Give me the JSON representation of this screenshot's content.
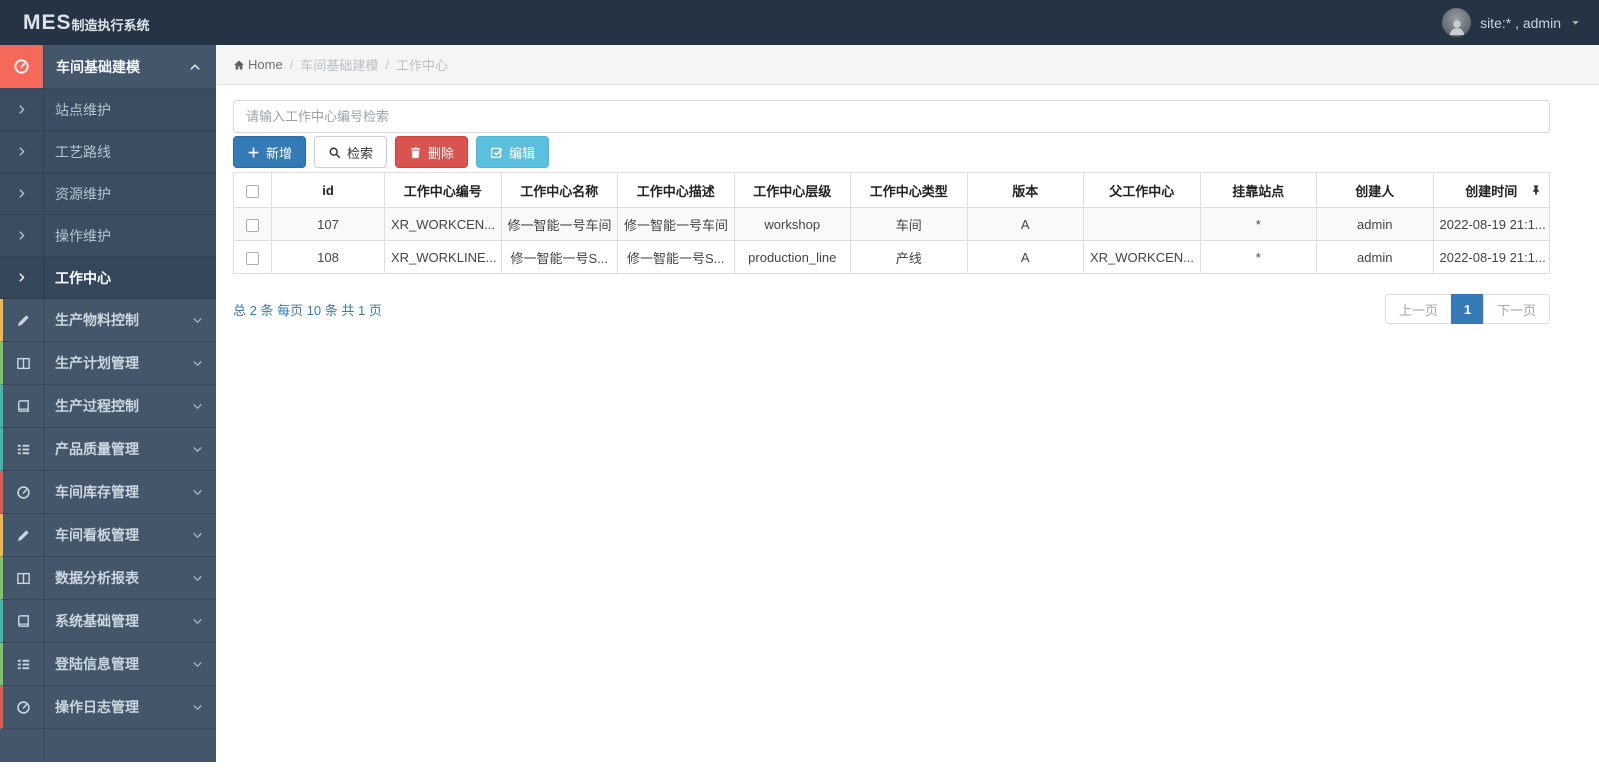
{
  "header": {
    "logo_mes": "MES",
    "logo_suffix": "制造执行系统",
    "user_label": "site:* , admin"
  },
  "sidebar": {
    "parent": {
      "label": "车间基础建模",
      "icon": "gauge-icon"
    },
    "submenu": [
      {
        "label": "站点维护",
        "icon": "chevron-right-icon",
        "active": false
      },
      {
        "label": "工艺路线",
        "icon": "chevron-right-icon",
        "active": false
      },
      {
        "label": "资源维护",
        "icon": "chevron-right-icon",
        "active": false
      },
      {
        "label": "操作维护",
        "icon": "chevron-right-icon",
        "active": false
      },
      {
        "label": "工作中心",
        "icon": "chevron-right-icon",
        "active": true
      }
    ],
    "items": [
      {
        "label": "生产物料控制",
        "icon": "pencil-icon",
        "accent": "#efb74d"
      },
      {
        "label": "生产计划管理",
        "icon": "columns-icon",
        "accent": "#7cc36a"
      },
      {
        "label": "生产过程控制",
        "icon": "book-icon",
        "accent": "#45b6aa"
      },
      {
        "label": "产品质量管理",
        "icon": "list-icon",
        "accent": "#45b6aa"
      },
      {
        "label": "车间库存管理",
        "icon": "gauge-icon",
        "accent": "#e25b52"
      },
      {
        "label": "车间看板管理",
        "icon": "pencil-icon",
        "accent": "#efb74d"
      },
      {
        "label": "数据分析报表",
        "icon": "columns-icon",
        "accent": "#7cc36a"
      },
      {
        "label": "系统基础管理",
        "icon": "book-icon",
        "accent": "#45b6aa"
      },
      {
        "label": "登陆信息管理",
        "icon": "list-icon",
        "accent": "#7cc36a"
      },
      {
        "label": "操作日志管理",
        "icon": "gauge-icon",
        "accent": "#e25b52"
      }
    ]
  },
  "breadcrumb": {
    "home": "Home",
    "sep": "/",
    "section": "车间基础建模",
    "page": "工作中心"
  },
  "toolbar": {
    "search_placeholder": "请输入工作中心编号检索",
    "add_label": "新增",
    "search_label": "检索",
    "delete_label": "删除",
    "edit_label": "编辑"
  },
  "table": {
    "columns": [
      "id",
      "工作中心编号",
      "工作中心名称",
      "工作中心描述",
      "工作中心层级",
      "工作中心类型",
      "版本",
      "父工作中心",
      "挂靠站点",
      "创建人",
      "创建时间"
    ],
    "rows": [
      {
        "id": "107",
        "code": "XR_WORKCEN...",
        "name": "修一智能一号车间",
        "desc": "修一智能一号车间",
        "level": "workshop",
        "type": "车间",
        "version": "A",
        "parent": "",
        "station": "*",
        "creator": "admin",
        "created": "2022-08-19 21:1..."
      },
      {
        "id": "108",
        "code": "XR_WORKLINE...",
        "name": "修一智能一号S...",
        "desc": "修一智能一号S...",
        "level": "production_line",
        "type": "产线",
        "version": "A",
        "parent": "XR_WORKCEN...",
        "station": "*",
        "creator": "admin",
        "created": "2022-08-19 21:1..."
      }
    ]
  },
  "footer": {
    "summary": "总 2 条  每页 10 条  共 1 页",
    "prev_label": "上一页",
    "current_page": "1",
    "next_label": "下一页"
  },
  "colors": {
    "navbar": "#243444",
    "sidebar": "#43566a",
    "submenu_bg": "#3b4e61",
    "active_submenu": "#35485b",
    "accent_red": "#f5695a",
    "primary": "#337ab7",
    "danger": "#d9534f",
    "info": "#5bc0de",
    "link": "#337ab7",
    "stripe": "#f9f9f9",
    "grid_border": "#dddddd"
  }
}
